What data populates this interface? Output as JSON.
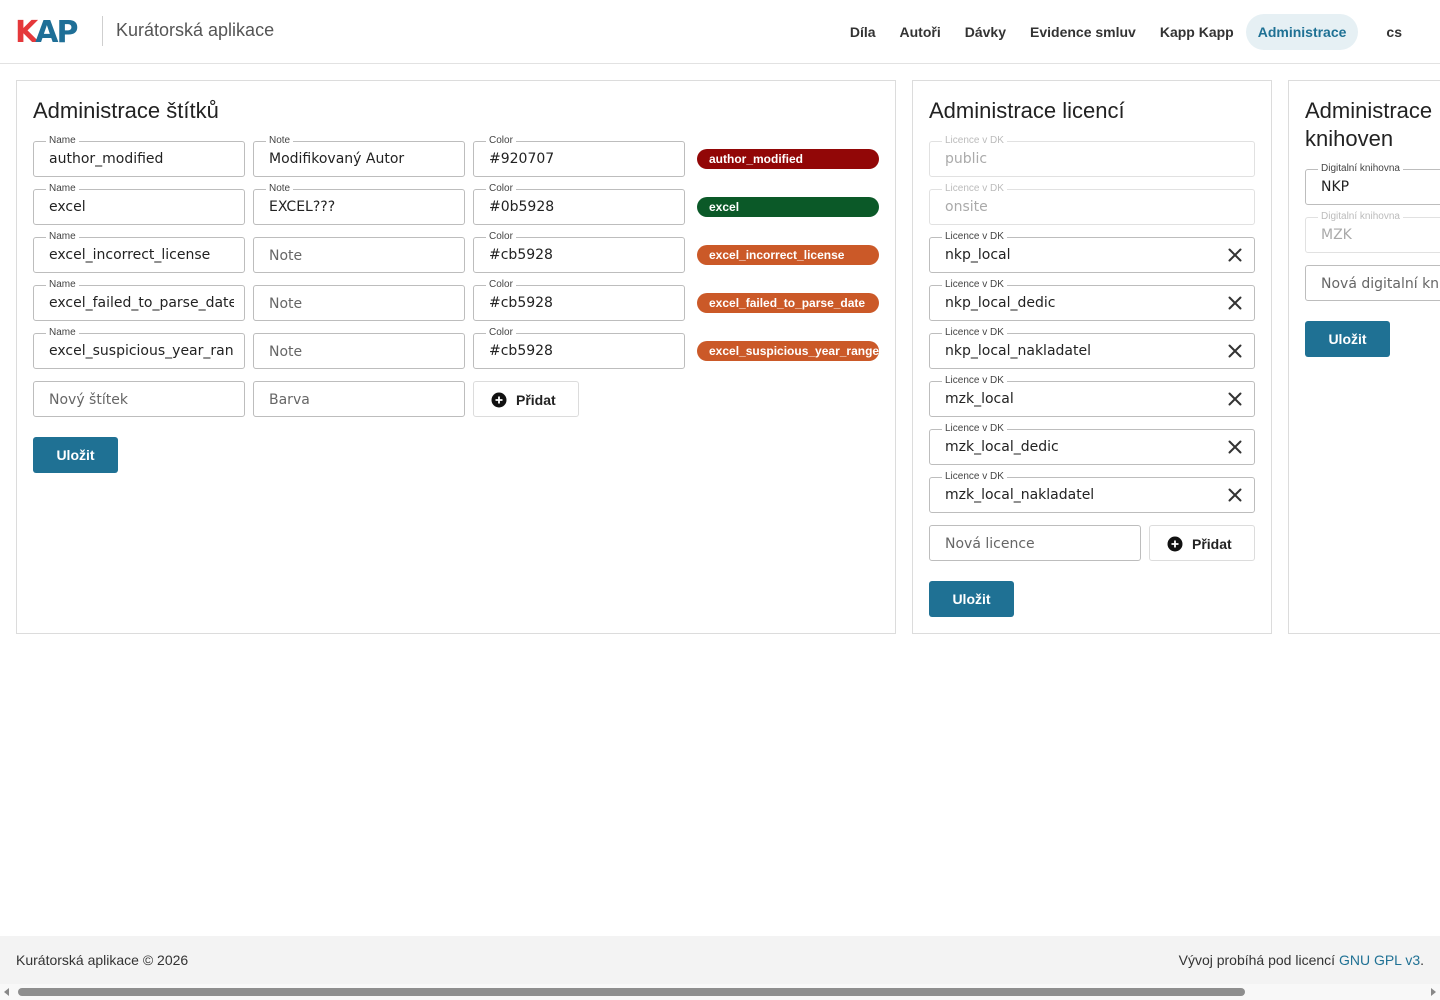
{
  "header": {
    "logo_k": "K",
    "logo_ap": "AP",
    "app_name": "Kurátorská aplikace",
    "nav": [
      {
        "label": "Díla"
      },
      {
        "label": "Autoři"
      },
      {
        "label": "Dávky"
      },
      {
        "label": "Evidence smluv"
      },
      {
        "label": "Kapp Kapp"
      },
      {
        "label": "Administrace",
        "active": true
      },
      {
        "label": "cs"
      }
    ]
  },
  "tags_panel": {
    "title": "Administrace štítků",
    "label_name": "Name",
    "label_note": "Note",
    "label_color": "Color",
    "rows": [
      {
        "name": "author_modified",
        "note": "Modifikovaný Autor",
        "color": "#920707"
      },
      {
        "name": "excel",
        "note": "EXCEL???",
        "color": "#0b5928"
      },
      {
        "name": "excel_incorrect_license",
        "note": "",
        "note_placeholder": "Note",
        "color": "#cb5928"
      },
      {
        "name": "excel_failed_to_parse_date",
        "note": "",
        "note_placeholder": "Note",
        "color": "#cb5928"
      },
      {
        "name": "excel_suspicious_year_range",
        "note": "",
        "note_placeholder": "Note",
        "color": "#cb5928"
      }
    ],
    "new_tag_placeholder": "Nový štítek",
    "new_color_placeholder": "Barva",
    "add_label": "Přidat",
    "save_label": "Uložit"
  },
  "licenses_panel": {
    "title": "Administrace licencí",
    "label": "Licence v DK",
    "items": [
      {
        "value": "public",
        "disabled": true
      },
      {
        "value": "onsite",
        "disabled": true
      },
      {
        "value": "nkp_local",
        "disabled": false
      },
      {
        "value": "nkp_local_dedic",
        "disabled": false
      },
      {
        "value": "nkp_local_nakladatel",
        "disabled": false
      },
      {
        "value": "mzk_local",
        "disabled": false
      },
      {
        "value": "mzk_local_dedic",
        "disabled": false
      },
      {
        "value": "mzk_local_nakladatel",
        "disabled": false
      }
    ],
    "new_placeholder": "Nová licence",
    "add_label": "Přidat",
    "save_label": "Uložit"
  },
  "libraries_panel": {
    "title_line1": "Administrace",
    "title_line2": "knihoven",
    "label": "Digitalní knihovna",
    "items": [
      {
        "value": "NKP",
        "disabled": false
      },
      {
        "value": "MZK",
        "disabled": true
      }
    ],
    "new_placeholder": "Nová digitalní knihovna",
    "save_label": "Uložit"
  },
  "footer": {
    "left": "Kurátorská aplikace © 2026",
    "right_prefix": "Vývoj probíhá pod licencí ",
    "license_link": "GNU GPL v3",
    "right_suffix": "."
  },
  "icons": {
    "clear": "close-icon",
    "add": "plus-circle-icon"
  }
}
